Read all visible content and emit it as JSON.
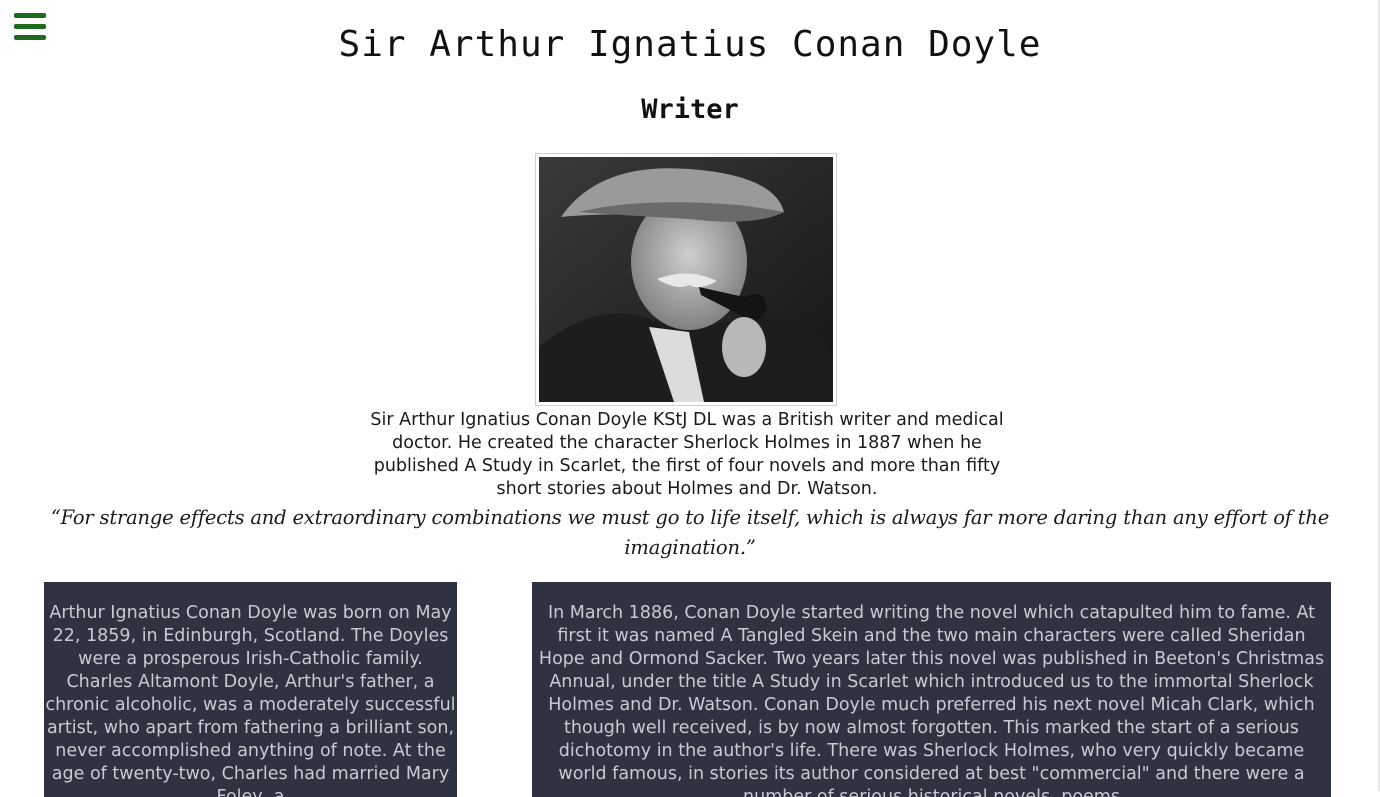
{
  "header": {
    "menu_icon": "hamburger-menu-icon",
    "menu_color": "#1e6b1e",
    "title": "Sir Arthur Ignatius Conan Doyle",
    "subtitle": "Writer"
  },
  "portrait": {
    "subject": "Black and white portrait of a man in a flat cap smoking a pipe"
  },
  "bio": "Sir Arthur Ignatius Conan Doyle KStJ DL was a British writer and medical doctor. He created the character Sherlock Holmes in 1887 when he published A Study in Scarlet, the first of four novels and more than fifty short stories about Holmes and Dr. Watson.",
  "quote": "“For strange effects and extraordinary combinations we must go to life itself, which is always far more daring than any effort of the imagination.”",
  "panels": {
    "background": "#2f3240",
    "left": "Arthur Ignatius Conan Doyle was born on May 22, 1859, in Edinburgh, Scotland. The Doyles were a prosperous Irish-Catholic family. Charles Altamont Doyle, Arthur's father, a chronic alcoholic, was a moderately successful artist, who apart from fathering a brilliant son, never accomplished anything of note. At the age of twenty-two, Charles had married Mary Foley, a",
    "right": "In March 1886, Conan Doyle started writing the novel which catapulted him to fame. At first it was named A Tangled Skein and the two main characters were called Sheridan Hope and Ormond Sacker. Two years later this novel was published in Beeton's Christmas Annual, under the title A Study in Scarlet which introduced us to the immortal Sherlock Holmes and Dr. Watson. Conan Doyle much preferred his next novel Micah Clark, which though well received, is by now almost forgotten. This marked the start of a serious dichotomy in the author's life. There was Sherlock Holmes, who very quickly became world famous, in stories its author considered at best \"commercial\" and there were a number of serious historical novels, poems"
  }
}
